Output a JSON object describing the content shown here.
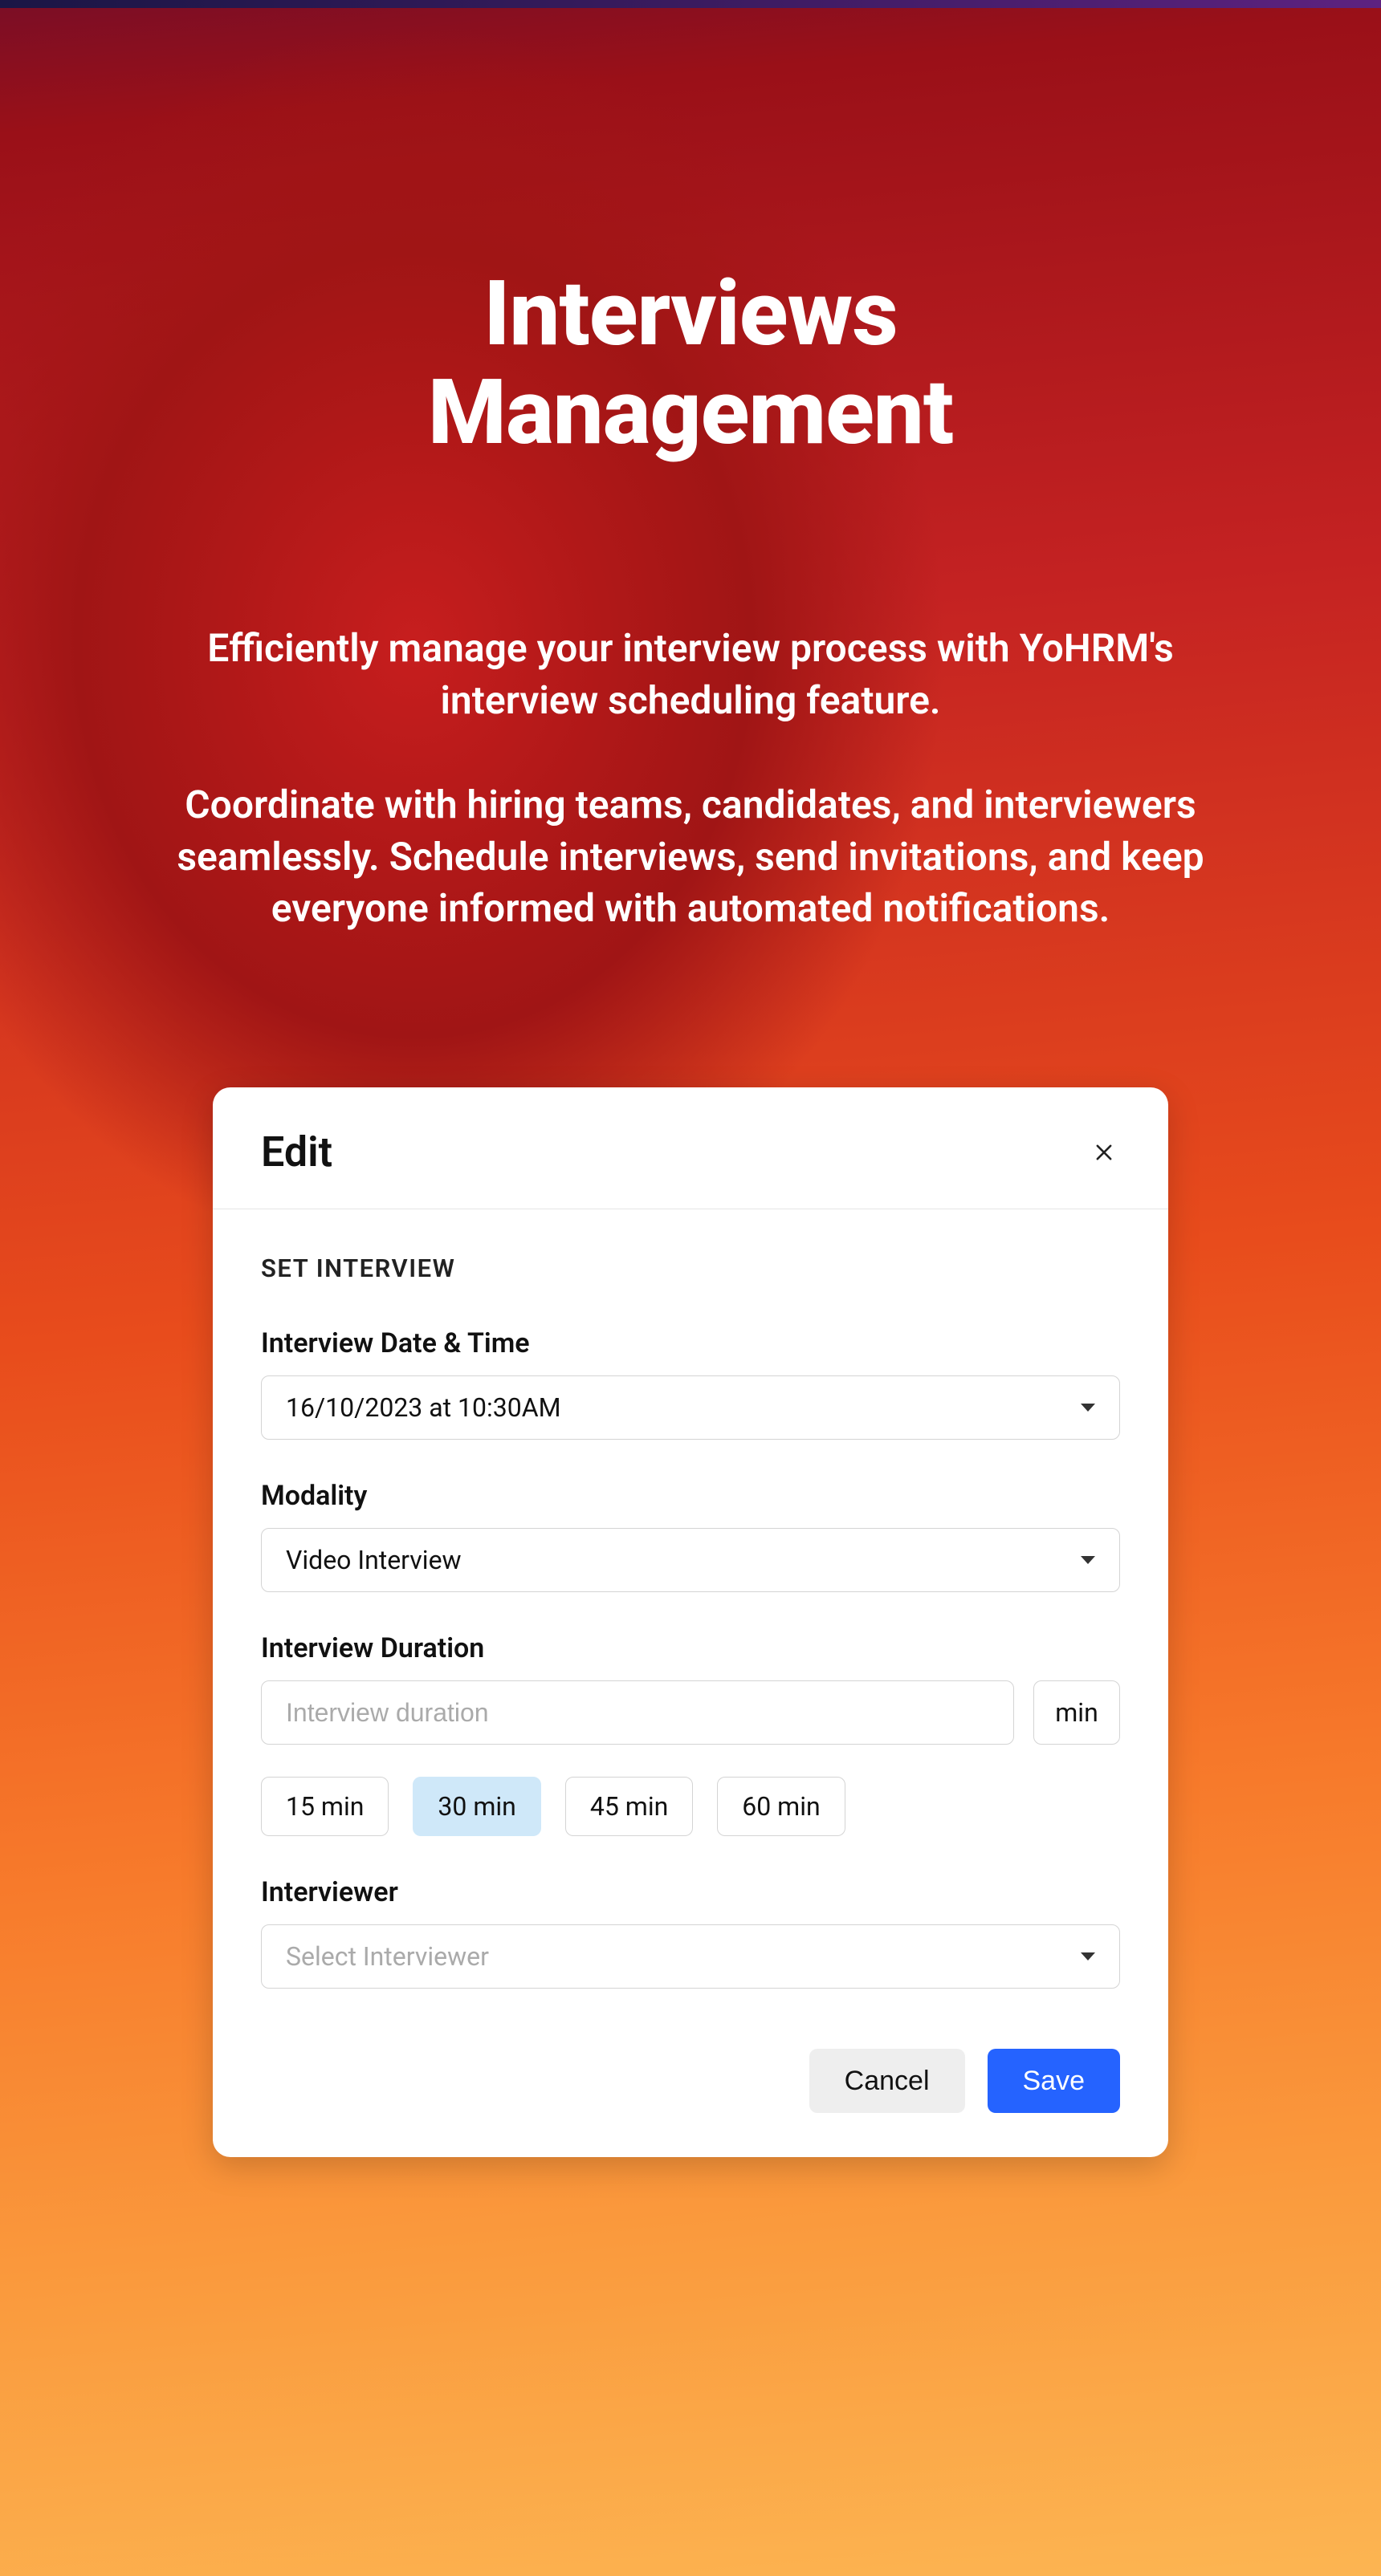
{
  "hero": {
    "title_line1": "Interviews",
    "title_line2": "Management",
    "paragraph1": "Efficiently manage your interview process with YoHRM's interview scheduling feature.",
    "paragraph2": "Coordinate with hiring teams, candidates, and interviewers seamlessly. Schedule interviews, send invitations, and keep everyone informed with automated notifications."
  },
  "modal": {
    "title": "Edit",
    "section_header": "SET INTERVIEW",
    "datetime": {
      "label": "Interview Date & Time",
      "value": "16/10/2023 at 10:30AM"
    },
    "modality": {
      "label": "Modality",
      "value": "Video Interview"
    },
    "duration": {
      "label": "Interview Duration",
      "placeholder": "Interview duration",
      "unit": "min",
      "chips": [
        "15 min",
        "30 min",
        "45 min",
        "60 min"
      ],
      "selected_index": 1
    },
    "interviewer": {
      "label": "Interviewer",
      "placeholder": "Select Interviewer"
    },
    "buttons": {
      "cancel": "Cancel",
      "save": "Save"
    }
  }
}
